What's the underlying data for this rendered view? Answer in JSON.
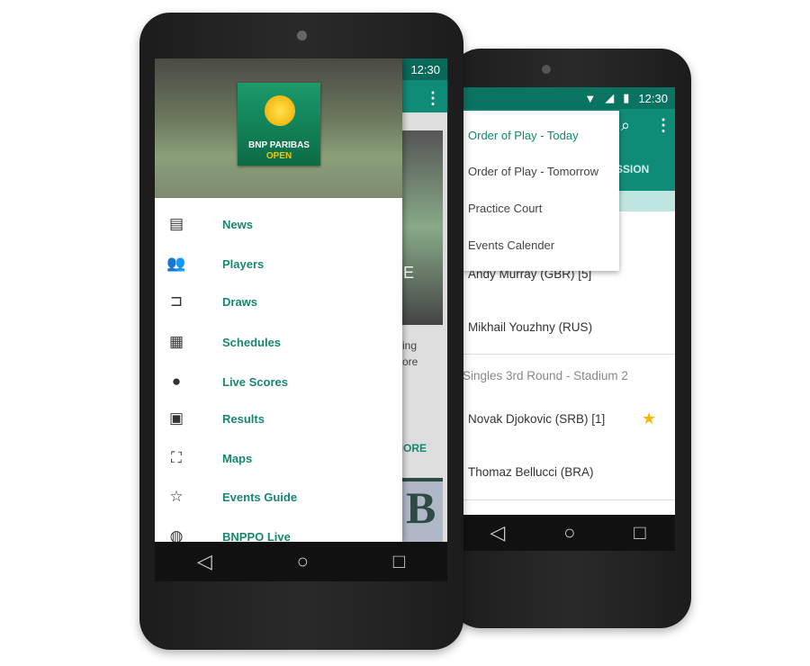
{
  "left_phone": {
    "status": {
      "time": "12:30"
    },
    "logo": {
      "line1": "BNP PARIBAS",
      "line2": "OPEN"
    },
    "drawer_items": [
      {
        "icon": "news-icon",
        "glyph": "▤",
        "label": "News"
      },
      {
        "icon": "players-icon",
        "glyph": "👥",
        "label": "Players"
      },
      {
        "icon": "draws-icon",
        "glyph": "⊐",
        "label": "Draws"
      },
      {
        "icon": "schedules-icon",
        "glyph": "▦",
        "label": "Schedules"
      },
      {
        "icon": "live-scores-icon",
        "glyph": "●",
        "label": "Live Scores"
      },
      {
        "icon": "results-icon",
        "glyph": "▣",
        "label": "Results"
      },
      {
        "icon": "maps-icon",
        "glyph": "⛶",
        "label": "Maps"
      },
      {
        "icon": "events-guide-icon",
        "glyph": "☆",
        "label": "Events Guide"
      },
      {
        "icon": "globe-icon",
        "glyph": "◍",
        "label": "BNPPO Live"
      }
    ],
    "background": {
      "text1": "ing",
      "text2": "ore",
      "more": "MORE",
      "letter": "B",
      "e": "E"
    }
  },
  "right_phone": {
    "status": {
      "time": "12:30"
    },
    "tab_partial": "SSION",
    "dropdown": [
      {
        "label": "Order of Play - Today",
        "selected": true
      },
      {
        "label": "Order of Play - Tomorrow",
        "selected": false
      },
      {
        "label": "Practice Court",
        "selected": false
      },
      {
        "label": "Events Calender",
        "selected": false
      }
    ],
    "rows": {
      "p1": "Andy Murray (GBR) [5]",
      "p2": "Mikhail Youzhny (RUS)",
      "section": "Singles 3rd Round - Stadium 2",
      "p3": "Novak Djokovic (SRB) [1]",
      "p4": "Thomaz Bellucci (BRA)"
    }
  },
  "colors": {
    "teal": "#0f8c78",
    "teal_dark": "#0b7362",
    "star": "#f6b800"
  }
}
